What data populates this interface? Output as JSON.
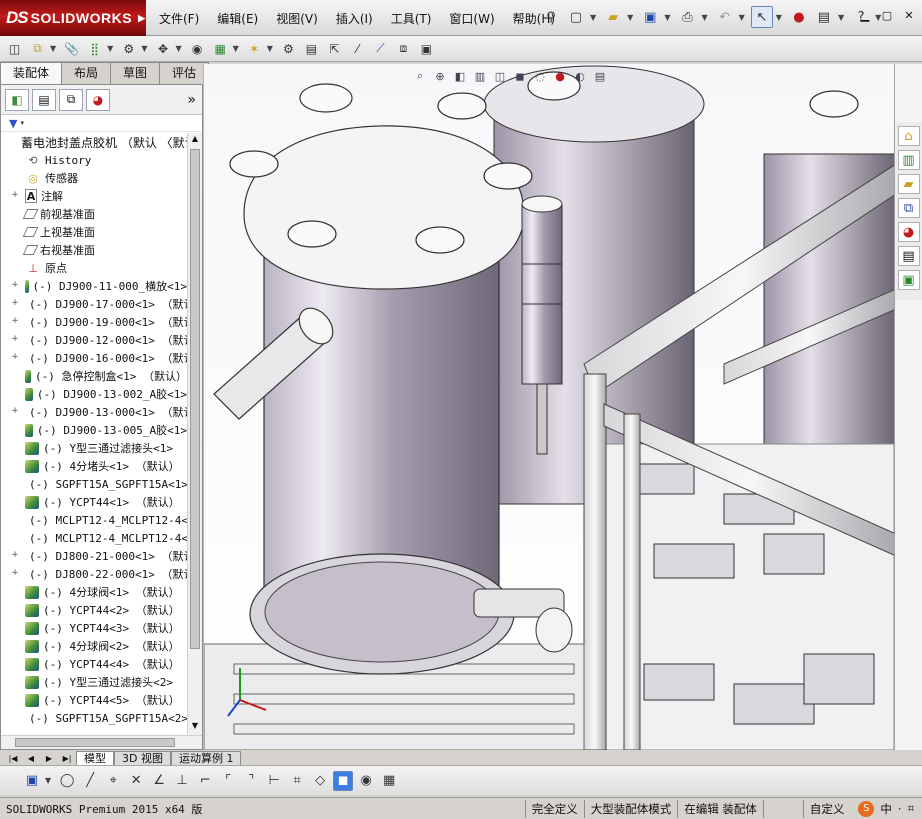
{
  "app": {
    "logo_prefix": "DS",
    "logo_name": "SOLIDWORKS"
  },
  "menu": [
    "文件(F)",
    "编辑(E)",
    "视图(V)",
    "插入(I)",
    "工具(T)",
    "窗口(W)",
    "帮助(H)"
  ],
  "title_tools": [
    "pin-icon",
    "new-document-icon",
    "open-folder-icon",
    "save-icon",
    "print-icon",
    "undo-icon",
    "select-pointer-icon",
    "rebuild-traffic-light-icon",
    "file-properties-icon",
    "help-icon"
  ],
  "window_controls": [
    "minimize-icon",
    "restore-icon",
    "close-icon"
  ],
  "command_tabs": [
    "装配体",
    "布局",
    "草图",
    "评估"
  ],
  "active_command_tab": 0,
  "tree": {
    "root": "蓄电池封盖点胶机 （默认 〈默认",
    "items": [
      {
        "label": "History",
        "icon": "history-icon",
        "expand": ""
      },
      {
        "label": "传感器",
        "icon": "sensor-icon",
        "expand": ""
      },
      {
        "label": "注解",
        "icon": "annotation-icon",
        "expand": "+"
      },
      {
        "label": "前视基准面",
        "icon": "plane-icon",
        "expand": ""
      },
      {
        "label": "上视基准面",
        "icon": "plane-icon",
        "expand": ""
      },
      {
        "label": "右视基准面",
        "icon": "plane-icon",
        "expand": ""
      },
      {
        "label": "原点",
        "icon": "origin-icon",
        "expand": ""
      },
      {
        "label": "(-) DJ900-11-000_横放<1>",
        "icon": "subassembly-icon",
        "expand": "+"
      },
      {
        "label": "(-) DJ900-17-000<1> （默认",
        "icon": "subassembly-icon",
        "expand": "+"
      },
      {
        "label": "(-) DJ900-19-000<1> （默认",
        "icon": "subassembly-icon",
        "expand": "+"
      },
      {
        "label": "(-) DJ900-12-000<1> （默认",
        "icon": "subassembly-icon",
        "expand": "+"
      },
      {
        "label": "(-) DJ900-16-000<1> （默认",
        "icon": "subassembly-icon",
        "expand": "+"
      },
      {
        "label": "(-) 急停控制盒<1> （默认）",
        "icon": "part-icon",
        "expand": ""
      },
      {
        "label": "(-) DJ900-13-002_A胶<1>",
        "icon": "part-icon",
        "expand": ""
      },
      {
        "label": "(-) DJ900-13-000<1> （默认",
        "icon": "subassembly-icon",
        "expand": "+"
      },
      {
        "label": "(-) DJ900-13-005_A胶<1>",
        "icon": "part-icon",
        "expand": ""
      },
      {
        "label": "(-) Y型三通过滤接头<1>",
        "icon": "part-icon",
        "expand": ""
      },
      {
        "label": "(-) 4分堵头<1> （默认）",
        "icon": "part-icon",
        "expand": ""
      },
      {
        "label": "(-) SGPFT15A_SGPFT15A<1>",
        "icon": "part-icon",
        "expand": ""
      },
      {
        "label": "(-) YCPT44<1> （默认）",
        "icon": "part-icon",
        "expand": ""
      },
      {
        "label": "(-) MCLPT12-4_MCLPT12-4<",
        "icon": "part-icon",
        "expand": ""
      },
      {
        "label": "(-) MCLPT12-4_MCLPT12-4<",
        "icon": "part-icon",
        "expand": ""
      },
      {
        "label": "(-) DJ800-21-000<1> （默认",
        "icon": "subassembly-icon",
        "expand": "+"
      },
      {
        "label": "(-) DJ800-22-000<1> （默认",
        "icon": "subassembly-icon",
        "expand": "+"
      },
      {
        "label": "(-) 4分球阀<1> （默认）",
        "icon": "part-icon",
        "expand": ""
      },
      {
        "label": "(-) YCPT44<2> （默认）",
        "icon": "part-icon",
        "expand": ""
      },
      {
        "label": "(-) YCPT44<3> （默认）",
        "icon": "part-icon",
        "expand": ""
      },
      {
        "label": "(-) 4分球阀<2> （默认）",
        "icon": "part-icon",
        "expand": ""
      },
      {
        "label": "(-) YCPT44<4> （默认）",
        "icon": "part-icon",
        "expand": ""
      },
      {
        "label": "(-) Y型三通过滤接头<2>",
        "icon": "part-icon",
        "expand": ""
      },
      {
        "label": "(-) YCPT44<5> （默认）",
        "icon": "part-icon",
        "expand": ""
      },
      {
        "label": "(-) SGPFT15A_SGPFT15A<2>",
        "icon": "part-icon",
        "expand": ""
      }
    ]
  },
  "bottom_tabs": [
    "模型",
    "3D 视图",
    "运动算例 1"
  ],
  "active_bottom_tab": 0,
  "status": {
    "app_version": "SOLIDWORKS Premium 2015 x64 版",
    "cells": [
      "完全定义",
      "大型装配体模式",
      "在编辑 装配体",
      "",
      "自定义"
    ],
    "ime_label": "中"
  }
}
